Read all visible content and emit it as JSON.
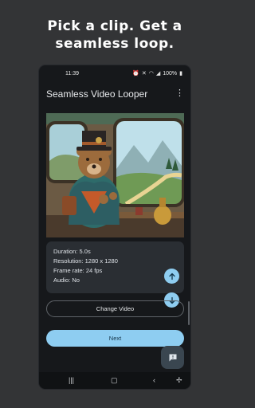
{
  "promo": {
    "headline_line1": "Pick a clip. Get a",
    "headline_line2": "seamless loop."
  },
  "status_bar": {
    "time": "11:39",
    "battery": "100%"
  },
  "app_bar": {
    "title": "Seamless Video Looper",
    "menu_icon": "more-vert-icon"
  },
  "video_info": {
    "duration": "Duration: 5.0s",
    "resolution": "Resolution: 1280 x 1280",
    "frame_rate": "Frame rate: 24 fps",
    "audio": "Audio: No"
  },
  "buttons": {
    "change_video": "Change Video",
    "next": "Next"
  },
  "icons": {
    "scroll_up": "arrow-up-icon",
    "scroll_down": "arrow-down-icon",
    "feedback": "feedback-icon"
  },
  "colors": {
    "accent": "#8ecdf1",
    "screen_bg": "#16181b",
    "card_bg": "#2a2e33"
  }
}
